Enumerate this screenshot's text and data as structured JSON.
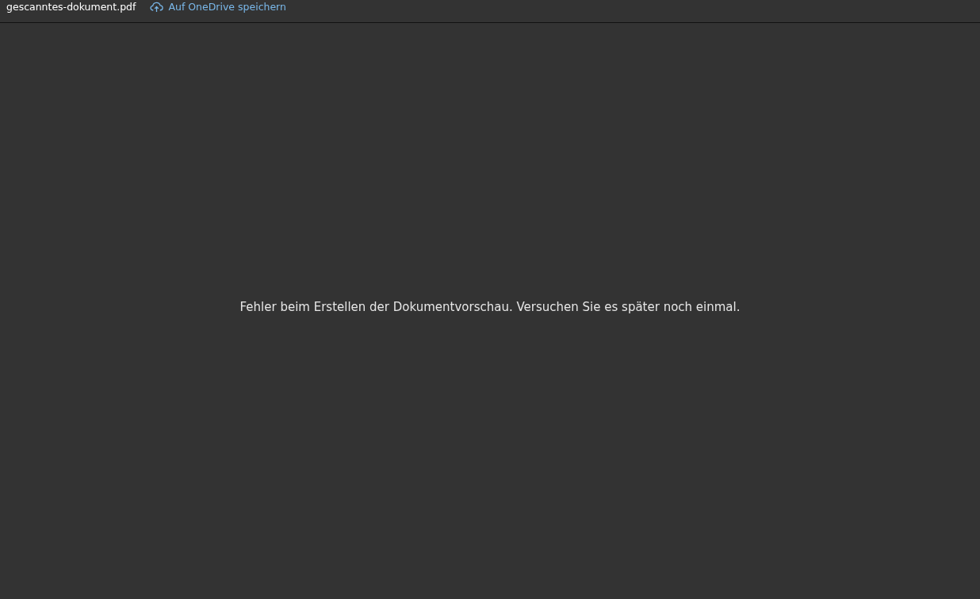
{
  "header": {
    "file_name": "gescanntes-dokument.pdf",
    "save_link": "Auf OneDrive speichern"
  },
  "preview": {
    "message": "Fehler beim Erstellen der Dokumentvorschau. Versuchen Sie es später noch einmal."
  }
}
